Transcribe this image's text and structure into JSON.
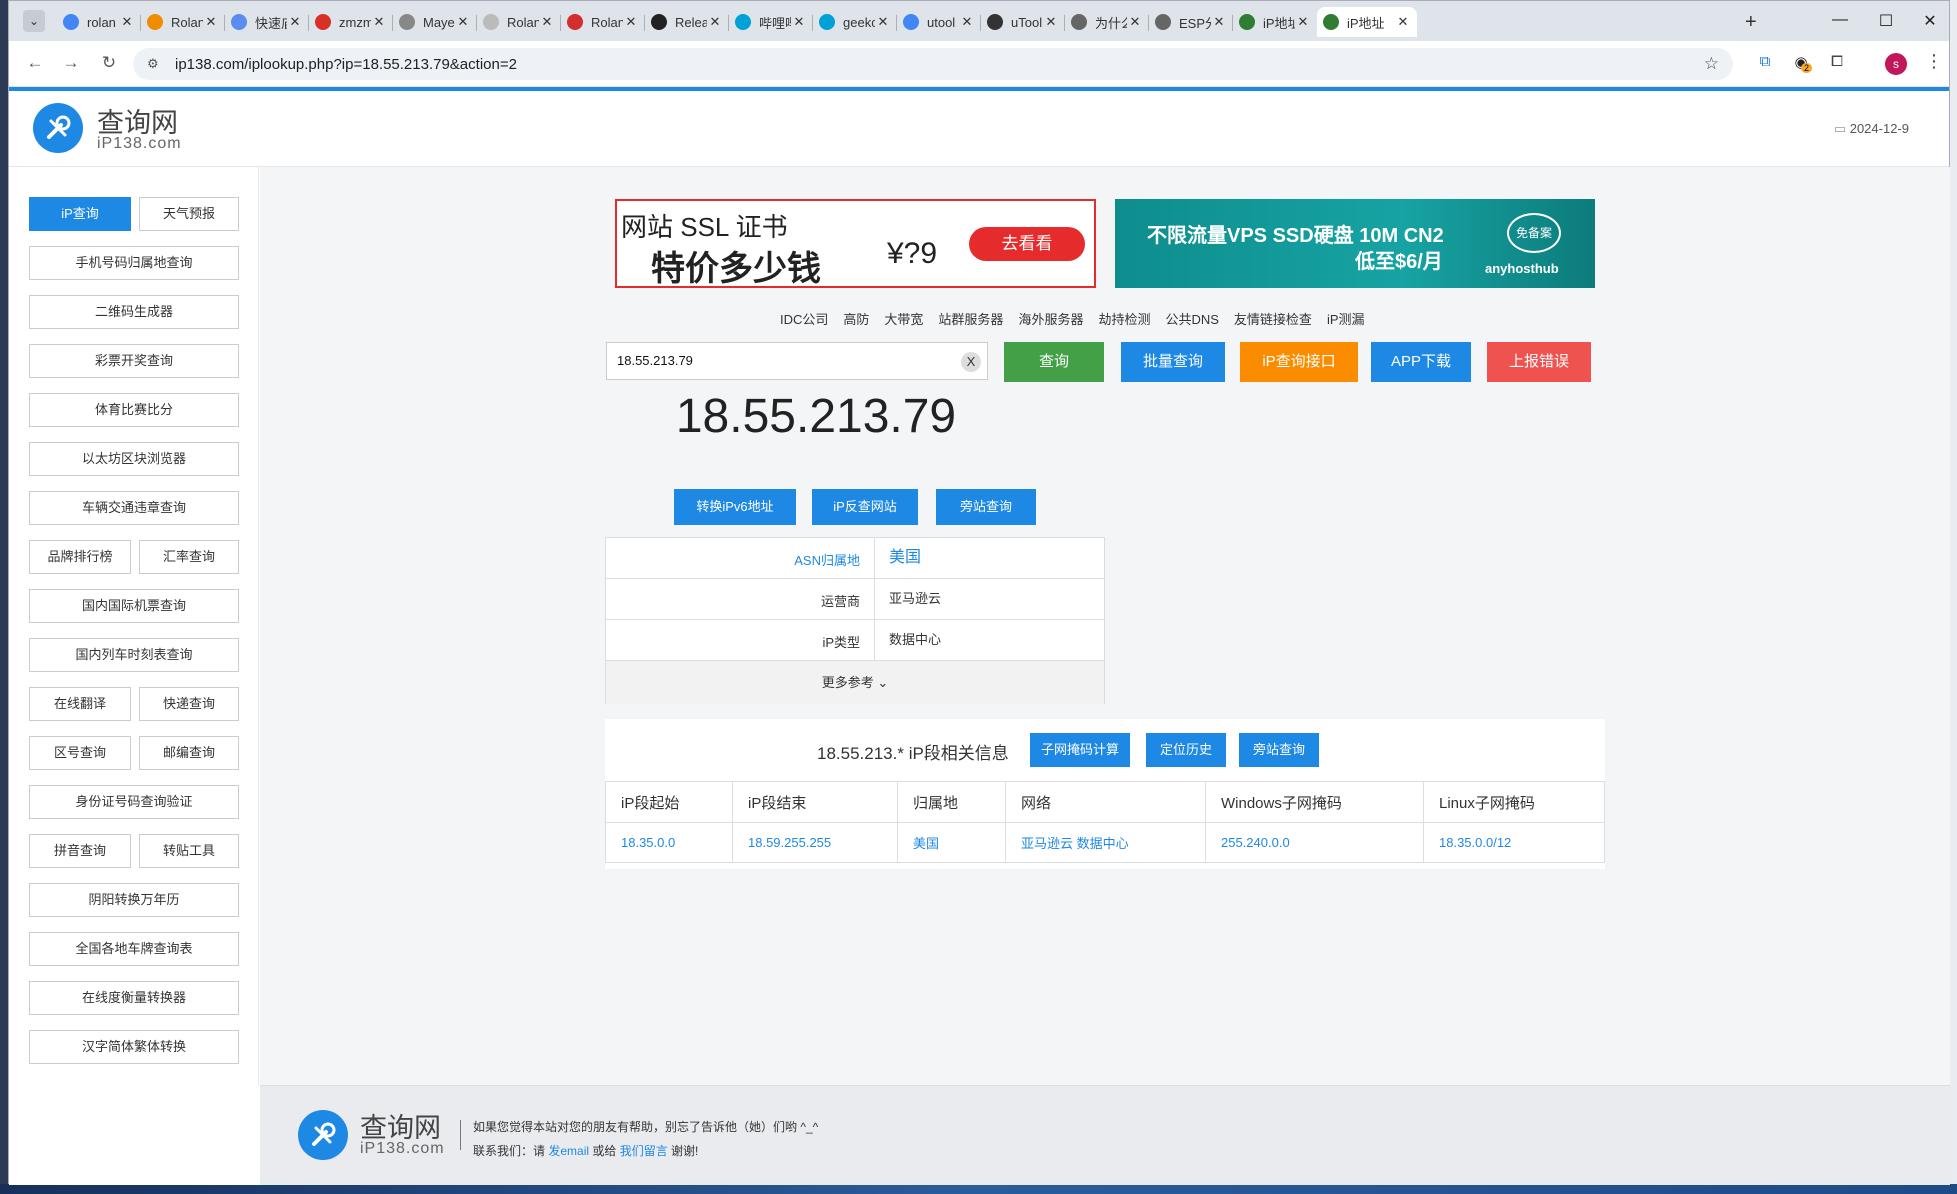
{
  "browser": {
    "tabs": [
      {
        "title": "rolan",
        "icon": "google-icon",
        "color": "#4285f4"
      },
      {
        "title": "Rolan",
        "icon": "rolan-icon",
        "color": "#f08c00"
      },
      {
        "title": "快速庙",
        "icon": "kuaisu-icon",
        "color": "#5b8def"
      },
      {
        "title": "zmzm",
        "icon": "zmz-icon",
        "color": "#d93025"
      },
      {
        "title": "Maye",
        "icon": "maye-icon",
        "color": "#888888"
      },
      {
        "title": "Rolan",
        "icon": "circle-icon",
        "color": "#bbbbbb"
      },
      {
        "title": "Rolan",
        "icon": "rolan-red-icon",
        "color": "#d32f2f"
      },
      {
        "title": "Relea",
        "icon": "github-icon",
        "color": "#222222"
      },
      {
        "title": "哔哩哔",
        "icon": "bilibili-icon",
        "color": "#00a1d6"
      },
      {
        "title": "geekc",
        "icon": "bilibili-icon",
        "color": "#00a1d6"
      },
      {
        "title": "utool",
        "icon": "google-icon",
        "color": "#4285f4"
      },
      {
        "title": "uTool",
        "icon": "utools-icon",
        "color": "#333333"
      },
      {
        "title": "为什么",
        "icon": "globe-icon",
        "color": "#666666"
      },
      {
        "title": "ESP分",
        "icon": "gear-icon",
        "color": "#666666"
      },
      {
        "title": "iP地址",
        "icon": "ip138-icon",
        "color": "#2e7d32"
      },
      {
        "title": "iP地址",
        "icon": "ip138-icon",
        "color": "#2e7d32"
      }
    ],
    "url": "ip138.com/iplookup.php?ip=18.55.213.79&action=2",
    "ext_badge": "2",
    "avatar_letter": "s"
  },
  "header": {
    "logo_name": "查询网",
    "logo_domain": "iP138.com",
    "date": "2024-12-9"
  },
  "sidebar": {
    "ip_query": "iP查询",
    "weather": "天气预报",
    "phone": "手机号码归属地查询",
    "qrcode": "二维码生成器",
    "lottery": "彩票开奖查询",
    "sports": "体育比赛比分",
    "ethereum": "以太坊区块浏览器",
    "traffic": "车辆交通违章查询",
    "brand": "品牌排行榜",
    "exchange": "汇率查询",
    "flight": "国内国际机票查询",
    "train": "国内列车时刻表查询",
    "translate": "在线翻译",
    "express": "快递查询",
    "areacode": "区号查询",
    "postcode": "邮编查询",
    "idcard": "身份证号码查询验证",
    "pinyin": "拼音查询",
    "repost": "转贴工具",
    "calendar": "阴阳转换万年历",
    "plate": "全国各地车牌查询表",
    "units": "在线度衡量转换器",
    "chinese": "汉字简体繁体转换"
  },
  "ads": {
    "ssl_line1": "网站 SSL 证书",
    "ssl_line2": "特价多少钱",
    "ssl_price": "¥?9",
    "ssl_button": "去看看",
    "vps_line1": "不限流量VPS SSD硬盘 10M CN2",
    "vps_line2": "低至$6/月",
    "vps_brand": "anyhosthub",
    "vps_stamp": "免备案"
  },
  "quicklinks": [
    "IDC公司",
    "高防",
    "大带宽",
    "站群服务器",
    "海外服务器",
    "劫持检测",
    "公共DNS",
    "友情链接检查",
    "iP测漏"
  ],
  "search": {
    "value": "18.55.213.79",
    "clear": "X",
    "query": "查询",
    "batch": "批量查询",
    "api": "iP查询接口",
    "app": "APP下载",
    "report": "上报错误"
  },
  "result": {
    "ip": "18.55.213.79",
    "btn_ipv6": "转换iPv6地址",
    "btn_reverse": "iP反查网站",
    "btn_sites": "旁站查询",
    "rows": [
      {
        "label": "ASN归属地",
        "value": "美国"
      },
      {
        "label": "运营商",
        "value": "亚马逊云"
      },
      {
        "label": "iP类型",
        "value": "数据中心"
      }
    ],
    "more": "更多参考"
  },
  "range": {
    "title": "18.55.213.* iP段相关信息",
    "btn_subnet": "子网掩码计算",
    "btn_history": "定位历史",
    "btn_sites": "旁站查询",
    "headers": [
      "iP段起始",
      "iP段结束",
      "归属地",
      "网络",
      "Windows子网掩码",
      "Linux子网掩码"
    ],
    "row": [
      "18.35.0.0",
      "18.59.255.255",
      "美国",
      "亚马逊云 数据中心",
      "255.240.0.0",
      "18.35.0.0/12"
    ]
  },
  "footer": {
    "logo_name": "查询网",
    "logo_domain": "iP138.com",
    "line1": "如果您觉得本站对您的朋友有帮助，别忘了告诉他（她）们哟 ^_^",
    "contact_prefix": "联系我们：请 ",
    "email": "发email",
    "or": " 或给 ",
    "message": "我们留言",
    "thanks": " 谢谢!"
  },
  "colors": {
    "accent": "#1e88e5",
    "green": "#43a047",
    "orange": "#fb8c00",
    "red": "#ef5350"
  }
}
